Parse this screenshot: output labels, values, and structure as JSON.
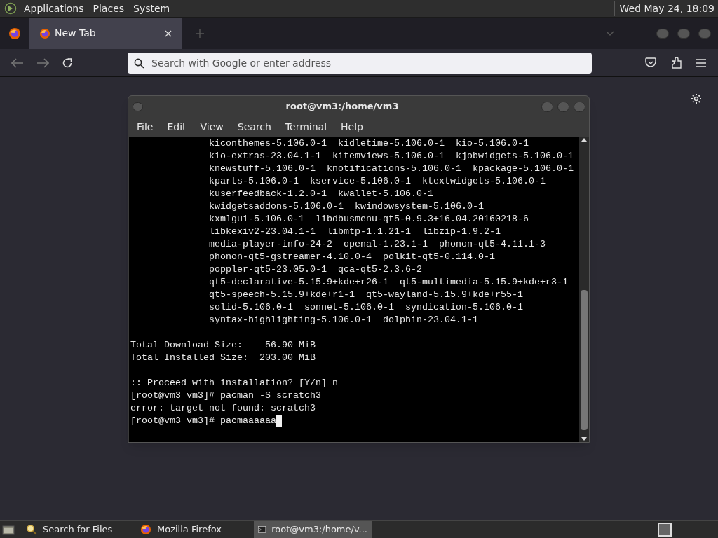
{
  "top_panel": {
    "menus": [
      "Applications",
      "Places",
      "System"
    ],
    "clock": "Wed May 24, 18:09"
  },
  "browser": {
    "tabs": [
      {
        "label": "New Tab",
        "selected": true
      }
    ],
    "address_placeholder": "Search with Google or enter address"
  },
  "terminal": {
    "title": "root@vm3:/home/vm3",
    "menus": [
      "File",
      "Edit",
      "View",
      "Search",
      "Terminal",
      "Help"
    ],
    "blocks": [
      {
        "kind": "packages",
        "lines": [
          "kiconthemes-5.106.0-1  kidletime-5.106.0-1  kio-5.106.0-1",
          "kio-extras-23.04.1-1  kitemviews-5.106.0-1  kjobwidgets-5.106.0-1",
          "knewstuff-5.106.0-1  knotifications-5.106.0-1  kpackage-5.106.0-1",
          "kparts-5.106.0-1  kservice-5.106.0-1  ktextwidgets-5.106.0-1",
          "kuserfeedback-1.2.0-1  kwallet-5.106.0-1",
          "kwidgetsaddons-5.106.0-1  kwindowsystem-5.106.0-1",
          "kxmlgui-5.106.0-1  libdbusmenu-qt5-0.9.3+16.04.20160218-6",
          "libkexiv2-23.04.1-1  libmtp-1.1.21-1  libzip-1.9.2-1",
          "media-player-info-24-2  openal-1.23.1-1  phonon-qt5-4.11.1-3",
          "phonon-qt5-gstreamer-4.10.0-4  polkit-qt5-0.114.0-1",
          "poppler-qt5-23.05.0-1  qca-qt5-2.3.6-2",
          "qt5-declarative-5.15.9+kde+r26-1  qt5-multimedia-5.15.9+kde+r3-1",
          "qt5-speech-5.15.9+kde+r1-1  qt5-wayland-5.15.9+kde+r55-1",
          "solid-5.106.0-1  sonnet-5.106.0-1  syndication-5.106.0-1",
          "syntax-highlighting-5.106.0-1  dolphin-23.04.1-1"
        ]
      },
      {
        "kind": "output",
        "lines": [
          "Total Download Size:    56.90 MiB",
          "Total Installed Size:  203.00 MiB"
        ]
      },
      {
        "kind": "output",
        "lines": [
          ":: Proceed with installation? [Y/n] n",
          "[root@vm3 vm3]# pacman -S scratch3",
          "error: target not found: scratch3",
          "[root@vm3 vm3]# pacmaaaaaa"
        ]
      }
    ],
    "cursor": true
  },
  "taskbar": {
    "items": [
      {
        "label": "Search for Files",
        "kind": "search",
        "selected": false
      },
      {
        "label": "Mozilla Firefox",
        "kind": "firefox",
        "selected": false
      },
      {
        "label": "root@vm3:/home/v...",
        "kind": "terminal",
        "selected": true
      }
    ]
  }
}
